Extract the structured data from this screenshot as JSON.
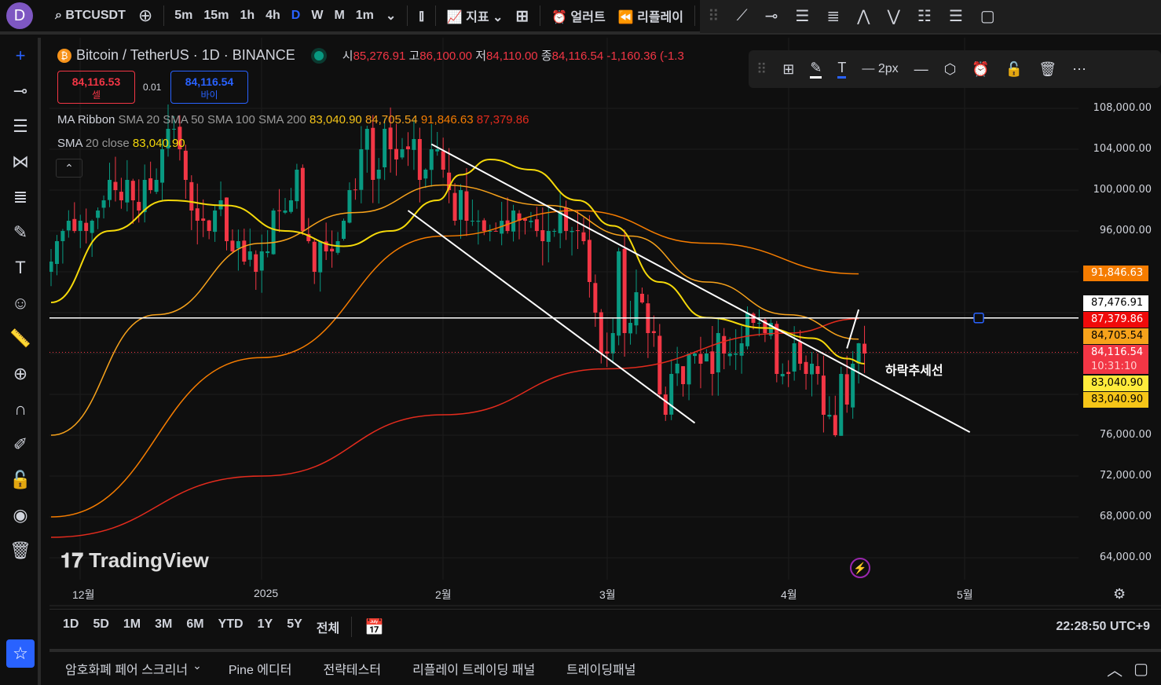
{
  "top": {
    "avatar": "D",
    "symbol": "BTCUSDT",
    "intervals": [
      "5m",
      "15m",
      "1h",
      "4h",
      "D",
      "W",
      "M",
      "1m"
    ],
    "active_interval": "D",
    "indicators": "지표",
    "alerts": "얼러트",
    "replay": "리플레이"
  },
  "legend": {
    "title": "Bitcoin / TetherUS · 1D · BINANCE",
    "o_label": "시",
    "o": "85,276.91",
    "h_label": "고",
    "h": "86,100.00",
    "l_label": "저",
    "l": "84,110.00",
    "c_label": "종",
    "c": "84,116.54",
    "change": "-1,160.36 (-1.3",
    "sell_price": "84,116.53",
    "sell_label": "셀",
    "spread": "0.01",
    "buy_price": "84,116.54",
    "buy_label": "바이",
    "ribbon_name": "MA Ribbon",
    "ribbon_params": "SMA 20 SMA 50 SMA 100 SMA 200",
    "ribbon_values": [
      "83,040.90",
      "84,705.54",
      "91,846.63",
      "87,379.86"
    ],
    "sma_name": "SMA",
    "sma_params": "20 close",
    "sma_value": "83,040.90"
  },
  "float_toolbar": {
    "width_label": "2px"
  },
  "colors": {
    "up": "#089981",
    "down": "#f23645",
    "sma20": "#f5d90a",
    "sma50": "#f7a21b",
    "sma100": "#f57c00",
    "sma200": "#e32b1d",
    "trend": "#ffffff"
  },
  "price_axis": [
    "108,000.00",
    "104,000.00",
    "100,000.00",
    "96,000.00",
    "76,000.00",
    "72,000.00",
    "68,000.00",
    "64,000.00"
  ],
  "price_tags": [
    {
      "text": "91,846.63",
      "bg": "#f57c00",
      "fg": "#ffffff"
    },
    {
      "text": "87,476.91",
      "bg": "#ffffff",
      "fg": "#000000"
    },
    {
      "text": "87,379.86",
      "bg": "#f00a0a",
      "fg": "#ffffff"
    },
    {
      "text": "84,705.54",
      "bg": "#f7a21b",
      "fg": "#000000"
    },
    {
      "text": "84,116.54",
      "bg": "#f23645",
      "fg": "#ffffff"
    },
    {
      "text": "10:31:10",
      "bg": "#f23645",
      "fg": "#ffd0d0"
    },
    {
      "text": "83,040.90",
      "bg": "#ffeb3b",
      "fg": "#000000"
    },
    {
      "text": "83,040.90",
      "bg": "#f5c518",
      "fg": "#000000"
    }
  ],
  "time_axis": [
    "12월",
    "2025",
    "2월",
    "3월",
    "4월",
    "5월"
  ],
  "annotation": "하락추세선",
  "watermark": "TradingView",
  "chart_data": {
    "type": "candlestick",
    "x_start": "2024-11-25",
    "interval": "1D",
    "closes": [
      93,
      95,
      96,
      97,
      96,
      97,
      96,
      97,
      98,
      99,
      101,
      100,
      99,
      101,
      99,
      98,
      101,
      100,
      101,
      104,
      106,
      106,
      104,
      101,
      98,
      97,
      97,
      96,
      98,
      99,
      95,
      94,
      95,
      93,
      94,
      92,
      94,
      94,
      98,
      98,
      98,
      99,
      102,
      96,
      95,
      92,
      95,
      94,
      94,
      95,
      97,
      100,
      100,
      104,
      106,
      101,
      102,
      106,
      104,
      103,
      104,
      104,
      105,
      101,
      102,
      104,
      104,
      102,
      100,
      97,
      100,
      97,
      97,
      97,
      96,
      96,
      96,
      97,
      96,
      98,
      97,
      97,
      97,
      96,
      95,
      96,
      96,
      98,
      96,
      96,
      96,
      95,
      91,
      88,
      84,
      84,
      86,
      94,
      86,
      87,
      90,
      89,
      86,
      86,
      80,
      78,
      82,
      83,
      81,
      84,
      84,
      83,
      84,
      82,
      86,
      84,
      84,
      84,
      85,
      88,
      87,
      87,
      86,
      87,
      82,
      82,
      82,
      85,
      83,
      82,
      83,
      82,
      78,
      78,
      76,
      82,
      79,
      83,
      85,
      84
    ],
    "price_unit": "thousand USDT",
    "ylim": [
      62000,
      110000
    ],
    "ma": {
      "sma20": [
        [
          0,
          89
        ],
        [
          10,
          96
        ],
        [
          20,
          99
        ],
        [
          30,
          98.5
        ],
        [
          40,
          96
        ],
        [
          50,
          94.5
        ],
        [
          58,
          96
        ],
        [
          66,
          99
        ],
        [
          70,
          101.5
        ],
        [
          75,
          103
        ],
        [
          82,
          102
        ],
        [
          90,
          99
        ],
        [
          96,
          96.5
        ],
        [
          104,
          91
        ],
        [
          112,
          87.5
        ],
        [
          122,
          86.5
        ],
        [
          130,
          85.5
        ],
        [
          136,
          83.5
        ],
        [
          139,
          83
        ]
      ],
      "sma50": [
        [
          0,
          76
        ],
        [
          18,
          87.8
        ],
        [
          36,
          94.8
        ],
        [
          52,
          97.8
        ],
        [
          67,
          100.5
        ],
        [
          85,
          98.5
        ],
        [
          99,
          95.5
        ],
        [
          112,
          91
        ],
        [
          126,
          87.8
        ],
        [
          138,
          85.4
        ]
      ],
      "sma100": [
        [
          0,
          68
        ],
        [
          36,
          83.6
        ],
        [
          67,
          95.5
        ],
        [
          90,
          98
        ],
        [
          112,
          94.8
        ],
        [
          138,
          91.8
        ]
      ],
      "sma200": [
        [
          0,
          66
        ],
        [
          36,
          72
        ],
        [
          67,
          78
        ],
        [
          95,
          82.5
        ],
        [
          126,
          86
        ],
        [
          138,
          87.4
        ]
      ]
    },
    "trendlines": [
      [
        [
          65,
          104.5
        ],
        [
          157,
          76.3
        ]
      ],
      [
        [
          61,
          98
        ],
        [
          110,
          77.2
        ]
      ],
      [
        [
          136,
          84.5
        ],
        [
          138,
          88.3
        ]
      ]
    ],
    "hline": 87.48
  },
  "range": {
    "buttons": [
      "1D",
      "5D",
      "1M",
      "3M",
      "6M",
      "YTD",
      "1Y",
      "5Y",
      "전체"
    ],
    "clock": "22:28:50 UTC+9"
  },
  "bottom": {
    "tabs": [
      "암호화폐 페어 스크리너",
      "Pine 에디터",
      "전략테스터",
      "리플레이 트레이딩 패널",
      "트레이딩패널"
    ]
  }
}
